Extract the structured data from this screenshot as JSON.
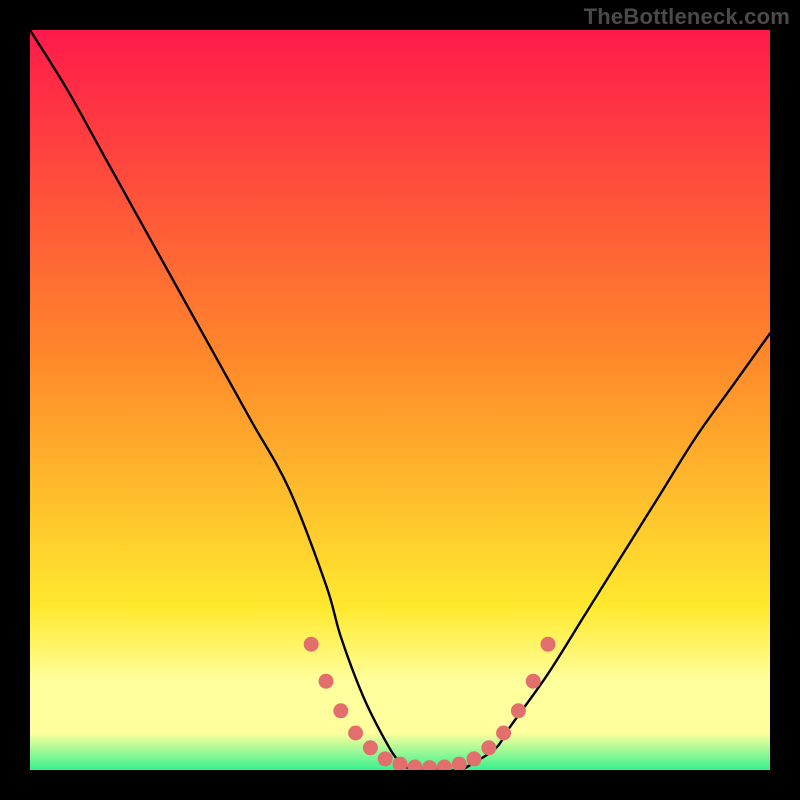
{
  "watermark": "TheBottleneck.com",
  "colors": {
    "page_bg": "#000000",
    "grad_top": "#ff1a4b",
    "grad_mid1": "#ff8a2a",
    "grad_mid2": "#ffe92e",
    "grad_band": "#ffff9d",
    "grad_bottom": "#37f28f",
    "curve": "#000000",
    "marker": "#e26f6b"
  },
  "chart_data": {
    "type": "line",
    "title": "",
    "xlabel": "",
    "ylabel": "",
    "xlim": [
      0,
      100
    ],
    "ylim": [
      0,
      100
    ],
    "series": [
      {
        "name": "bottleneck-curve",
        "x": [
          0,
          5,
          10,
          15,
          20,
          25,
          30,
          35,
          40,
          42,
          45,
          48,
          50,
          52,
          55,
          58,
          60,
          63,
          65,
          70,
          75,
          80,
          85,
          90,
          95,
          100
        ],
        "y": [
          100,
          92,
          83,
          74,
          65,
          56,
          47,
          38,
          25,
          18,
          10,
          4,
          1,
          0,
          0,
          0,
          1,
          3,
          6,
          13,
          21,
          29,
          37,
          45,
          52,
          59
        ]
      }
    ],
    "markers": {
      "name": "highlight-points",
      "x": [
        38,
        40,
        42,
        44,
        46,
        48,
        50,
        52,
        54,
        56,
        58,
        60,
        62,
        64,
        66,
        68,
        70
      ],
      "y": [
        17,
        12,
        8,
        5,
        3,
        1.5,
        0.8,
        0.4,
        0.3,
        0.4,
        0.8,
        1.5,
        3,
        5,
        8,
        12,
        17
      ]
    }
  }
}
